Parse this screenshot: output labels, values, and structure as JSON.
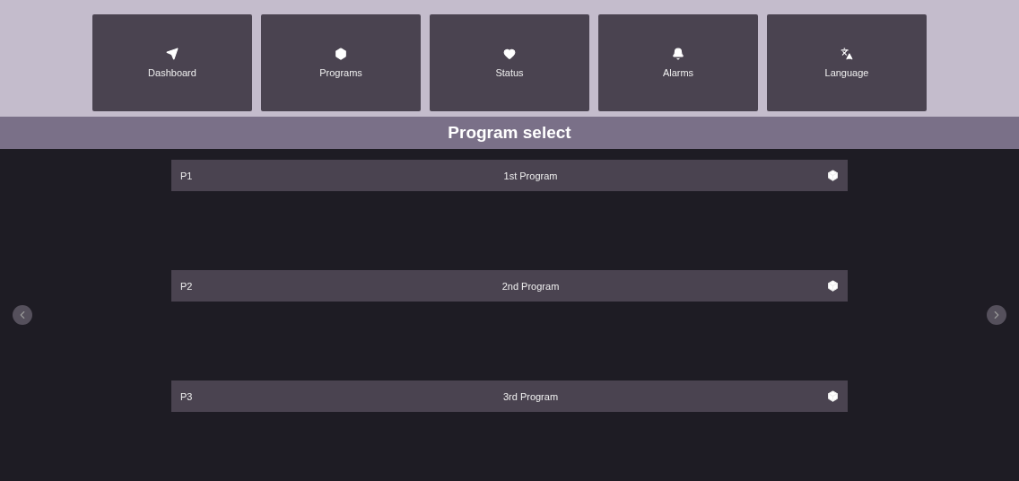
{
  "nav": [
    {
      "kind": "dashboard",
      "label": "Dashboard"
    },
    {
      "kind": "programs",
      "label": "Programs"
    },
    {
      "kind": "status",
      "label": "Status"
    },
    {
      "kind": "alarms",
      "label": "Alarms"
    },
    {
      "kind": "language",
      "label": "Language"
    }
  ],
  "title": "Program select",
  "programs": [
    {
      "code": "P1",
      "name": "1st Program"
    },
    {
      "code": "P2",
      "name": "2nd Program"
    },
    {
      "code": "P3",
      "name": "3rd Program"
    }
  ]
}
